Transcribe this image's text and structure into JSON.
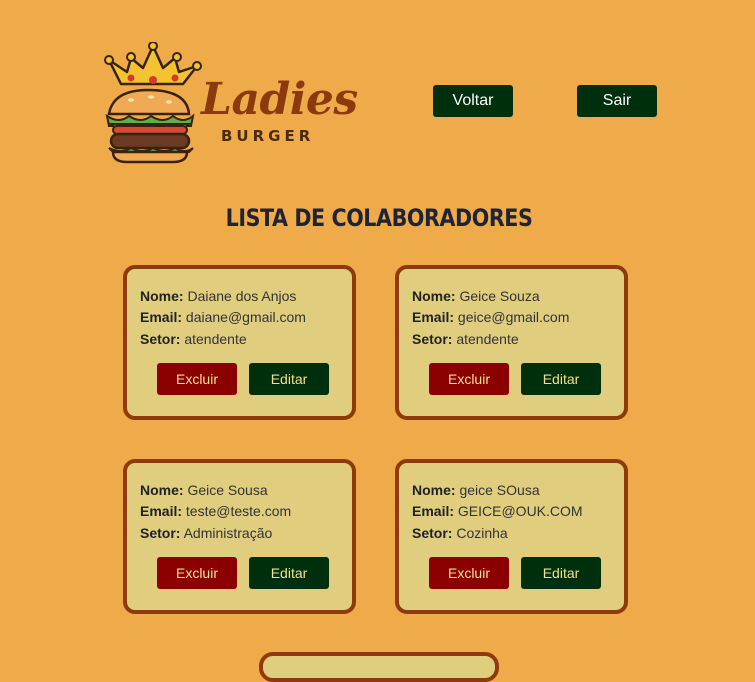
{
  "logo": {
    "title": "Ladies",
    "subtitle": "BURGER"
  },
  "nav": {
    "voltar_label": "Voltar",
    "sair_label": "Sair"
  },
  "page": {
    "title": "LISTA DE COLABORADORES"
  },
  "labels": {
    "nome": "Nome:",
    "email": "Email:",
    "setor": "Setor:"
  },
  "actions": {
    "excluir": "Excluir",
    "editar": "Editar"
  },
  "colaboradores": [
    {
      "nome": "Daiane dos Anjos",
      "email": "daiane@gmail.com",
      "setor": "atendente"
    },
    {
      "nome": "Geice Souza",
      "email": "geice@gmail.com",
      "setor": "atendente"
    },
    {
      "nome": "Geice Sousa",
      "email": "teste@teste.com",
      "setor": "Administração"
    },
    {
      "nome": "geice SOusa",
      "email": "GEICE@OUK.COM",
      "setor": "Cozinha"
    }
  ],
  "colors": {
    "background": "#EFAB4A",
    "card": "#E0CE7E",
    "card_border": "#8F3A0C",
    "dark_green": "#002F0D",
    "dark_red": "#8B0000",
    "button_text_card": "#F2E08C"
  }
}
